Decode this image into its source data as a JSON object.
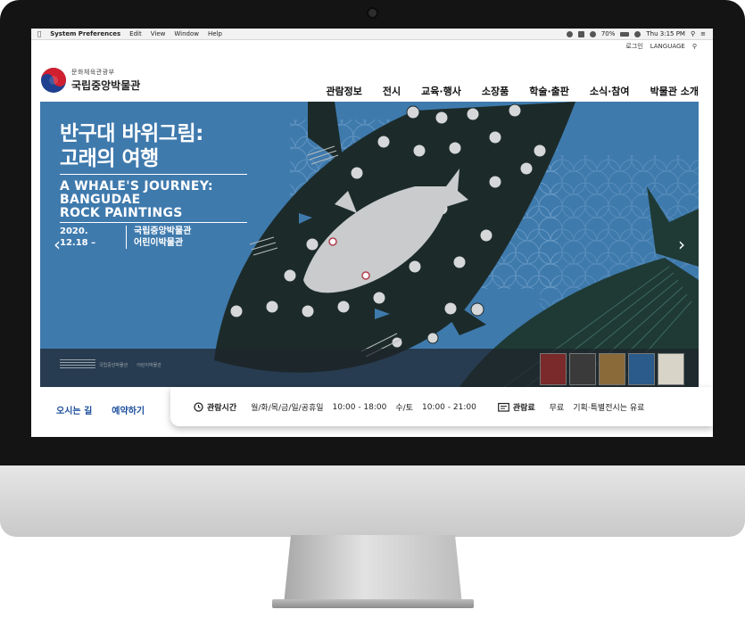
{
  "menubar": {
    "apple_icon": "apple-icon",
    "app_name": "System Preferences",
    "menus": [
      "Edit",
      "View",
      "Window",
      "Help"
    ],
    "battery": "70%",
    "clock": "Thu 3:15 PM"
  },
  "header": {
    "util_links": [
      "로그인",
      "LANGUAGE"
    ],
    "ministry": "문화체육관광부",
    "site_name": "국립중앙박물관",
    "nav": [
      "관람정보",
      "전시",
      "교육·행사",
      "소장품",
      "학술·출판",
      "소식·참여",
      "박물관 소개"
    ]
  },
  "hero": {
    "title_line1": "반구대 바위그림:",
    "title_line2": "고래의 여행",
    "en_line1": "A WHALE'S JOURNEY:",
    "en_line2": "BANGUDAE",
    "en_line3": "ROCK PAINTINGS",
    "date_line1": "2020.",
    "date_line2": "12.18 –",
    "venue_line1": "국립중앙박물관",
    "venue_line2": "어린이박물관",
    "prev_arrow": "‹",
    "next_arrow": "›",
    "strip_logo1": "국립중앙박물관",
    "strip_logo2": "어린이박물관",
    "thumb_colors": [
      "#7a2a2a",
      "#3a3a3a",
      "#8b6a3a",
      "#2b5b8a",
      "#d8d4c8"
    ]
  },
  "info": {
    "quick_links": [
      "오시는 길",
      "예약하기"
    ],
    "hours_label": "관람시간",
    "hours_days1": "월/화/목/금/일/공휴일",
    "hours_time1": "10:00 - 18:00",
    "hours_days2": "수/토",
    "hours_time2": "10:00 - 21:00",
    "fee_label": "관람료",
    "fee_free": "무료",
    "fee_note": "기획·특별전시는 유료"
  }
}
